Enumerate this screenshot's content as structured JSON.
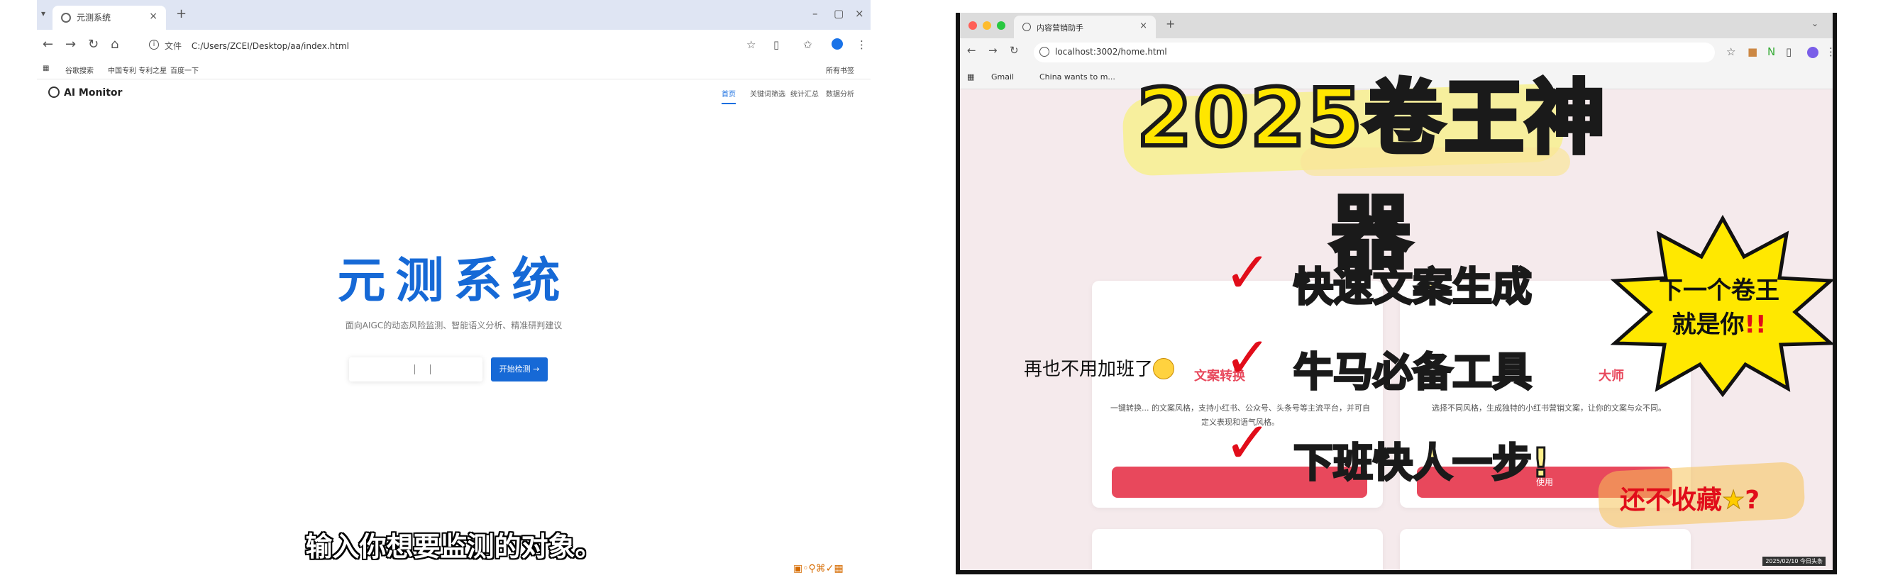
{
  "left": {
    "tab_title": "元测系统",
    "url_tag": "文件",
    "url": "C:/Users/ZCEI/Desktop/aa/index.html",
    "bookmarks": [
      "谷歌搜索",
      "中国专利 专利之星",
      "百度一下"
    ],
    "bookmarks_right": "所有书签",
    "logo": "AI Monitor",
    "nav": [
      "首页",
      "关键词筛选",
      "统计汇总",
      "数据分析"
    ],
    "hero_title": "元测系统",
    "hero_subtitle": "面向AIGC的动态风险监测、智能语义分析、精准研判建议",
    "search_button": "开始检测 →",
    "caption": "输入你想要监测的对象。"
  },
  "right": {
    "tab_title": "内容营销助手",
    "url": "localhost:3002/home.html",
    "bookmarks": [
      "Gmail",
      "China wants to m..."
    ],
    "big_title": "2025卷王神器",
    "bullets": [
      "快速文案生成",
      "牛马必备工具",
      "下班快人一步!"
    ],
    "burst_line1": "下一个卷王",
    "burst_line2": "就是你",
    "burst_mark": "!!",
    "handwriting": "再也不用加班了",
    "card_title_left": "文案转换",
    "card_title_right": "大师",
    "card_desc_left": "一键转换... 的文案风格，支持小红书、公众号、头条号等主流平台，并可自定义表现和语气风格。",
    "card_desc_right": "选择不同风格，生成独特的小红书营销文案，让你的文案与众不同。",
    "card_btn_right": "使用",
    "cta": "还不收藏",
    "cta_star": "★",
    "cta_q": "?",
    "stamp": "2025/02/10 今日头条"
  }
}
